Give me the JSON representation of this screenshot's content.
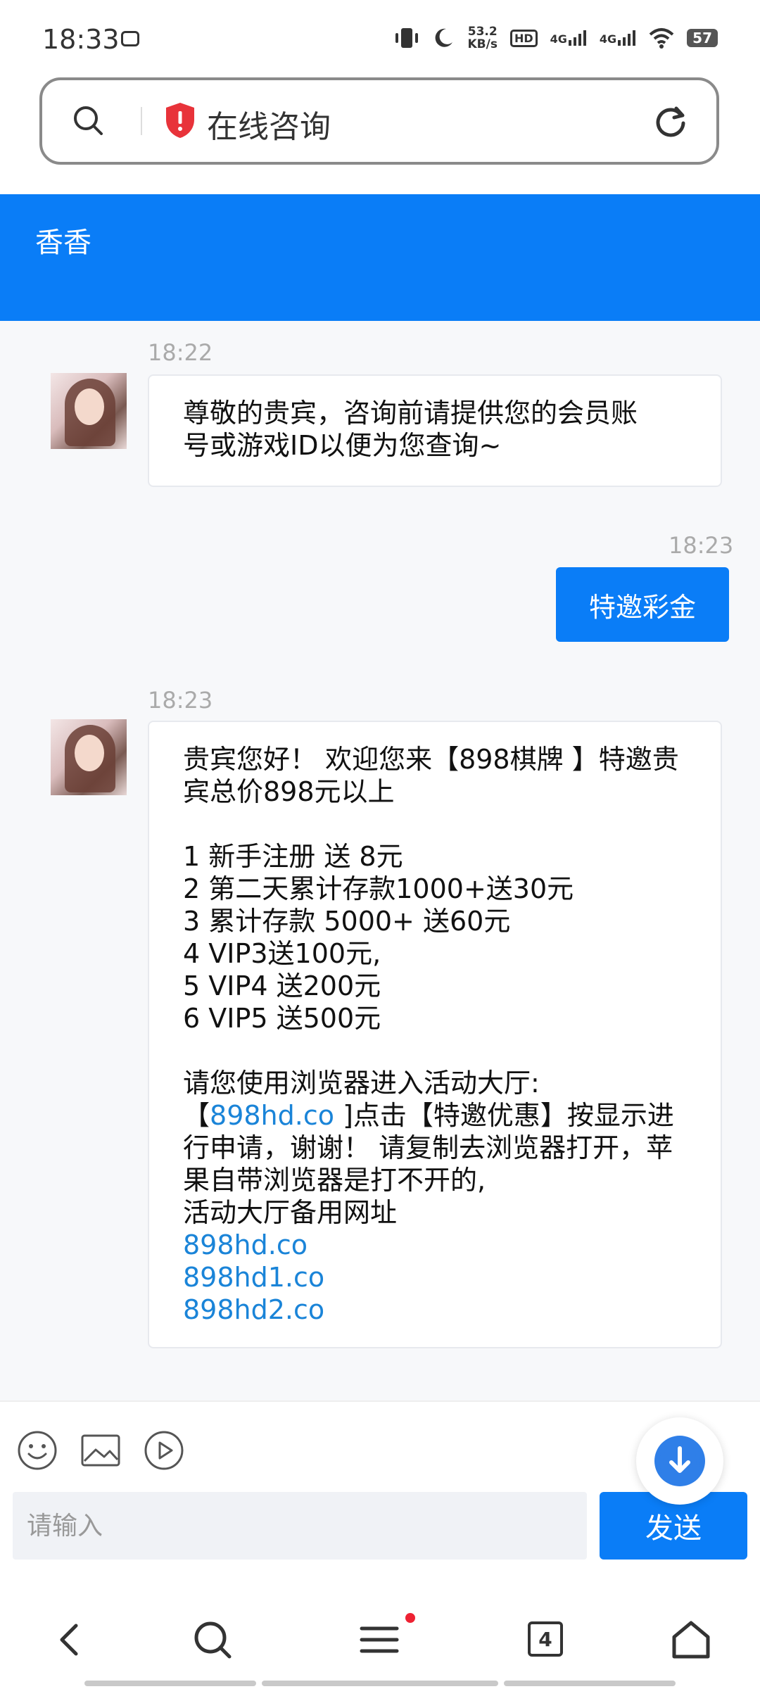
{
  "status_bar": {
    "time": "18:33",
    "net_speed_top": "53.2",
    "net_speed_unit": "KB/s",
    "hd_label": "HD",
    "signal_1": "4G",
    "signal_2": "4G",
    "battery": "57"
  },
  "address_bar": {
    "title": "在线咨询"
  },
  "chat": {
    "agent_name": "香香",
    "messages": [
      {
        "time": "18:22",
        "lines": [
          "尊敬的贵宾，咨询前请提供您的会员账",
          "号或游戏ID以便为您查询~"
        ]
      },
      {
        "time": "18:23",
        "text": "特邀彩金"
      },
      {
        "time": "18:23",
        "lines": [
          "贵宾您好！ 欢迎您来【898棋牌 】特邀贵",
          "宾总价898元以上",
          "",
          "1 新手注册 送 8元",
          "2 第二天累计存款1000+送30元",
          "3 累计存款 5000+ 送60元",
          "4 VIP3送100元,",
          "5 VIP4 送200元",
          "6 VIP5 送500元",
          "",
          "请您使用浏览器进入活动大厅:",
          "行申请，谢谢！ 请复制去浏览器打开，苹",
          "果自带浏览器是打不开的,",
          "活动大厅备用网址"
        ],
        "inline_prefix": "【",
        "inline_link": "898hd.co",
        "inline_suffix": " ]点击【特邀优惠】按显示进",
        "links": [
          "898hd.co",
          "898hd1.co",
          "898hd2.co"
        ]
      }
    ]
  },
  "composer": {
    "placeholder": "请输入",
    "send_label": "发送"
  },
  "bottom_nav": {
    "tab_count": "4"
  },
  "colors": {
    "accent": "#0a7df7",
    "link": "#1a84d8",
    "notification_dot": "#ee2233"
  }
}
